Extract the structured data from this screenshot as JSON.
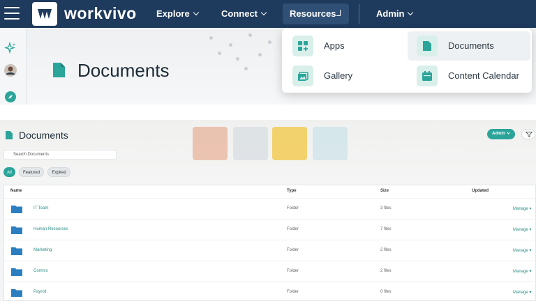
{
  "nav": {
    "brand": "workvivo",
    "items": [
      {
        "label": "Explore"
      },
      {
        "label": "Connect"
      },
      {
        "label": "Resources"
      },
      {
        "label": "Admin"
      }
    ]
  },
  "hero": {
    "title": "Documents"
  },
  "dropdown": {
    "items": [
      {
        "label": "Apps",
        "icon": "apps-grid-icon"
      },
      {
        "label": "Documents",
        "icon": "document-icon"
      },
      {
        "label": "Gallery",
        "icon": "gallery-icon"
      },
      {
        "label": "Content Calendar",
        "icon": "calendar-icon"
      }
    ]
  },
  "documents": {
    "title": "Documents",
    "admin_label": "Admin",
    "search_placeholder": "Search Documents",
    "filters": [
      "All",
      "Featured",
      "Expired"
    ],
    "columns": [
      "Name",
      "Type",
      "Size",
      "Updated"
    ],
    "rows": [
      {
        "name": "IT Team",
        "type": "Folder",
        "size": "3 files",
        "action": "Manage"
      },
      {
        "name": "Human Resources",
        "type": "Folder",
        "size": "7 files",
        "action": "Manage"
      },
      {
        "name": "Marketing",
        "type": "Folder",
        "size": "2 files",
        "action": "Manage"
      },
      {
        "name": "Comms",
        "type": "Folder",
        "size": "2 files",
        "action": "Manage"
      },
      {
        "name": "Payroll",
        "type": "Folder",
        "size": "0 files",
        "action": "Manage"
      }
    ]
  },
  "colors": {
    "navy": "#1e3a5c",
    "teal": "#2ba49a",
    "folder_blue": "#2b7fc0"
  }
}
